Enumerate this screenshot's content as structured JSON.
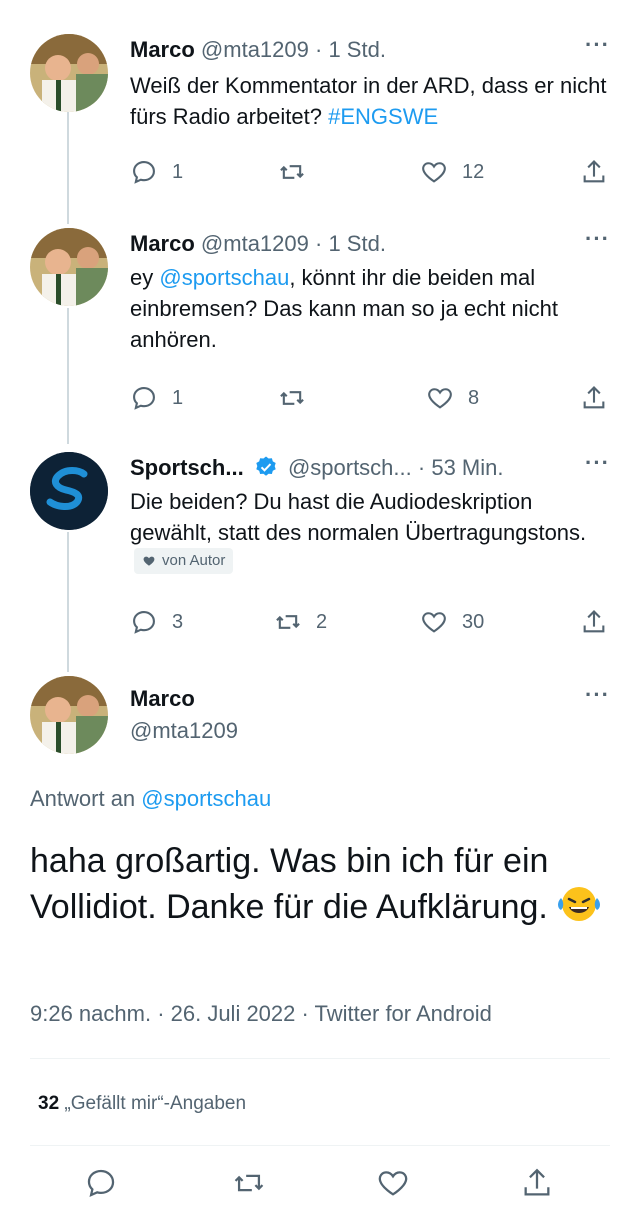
{
  "thread": [
    {
      "name": "Marco",
      "handle": "@mta1209",
      "separator": "·",
      "time": "1 Std.",
      "text_parts": [
        "Weiß der Kommentator in der ARD, dass er nicht fürs Radio arbeitet? ",
        "#ENGSWE"
      ],
      "replies": "1",
      "retweets": "",
      "likes": "12"
    },
    {
      "name": "Marco",
      "handle": "@mta1209",
      "separator": "·",
      "time": "1 Std.",
      "text_parts": [
        "ey ",
        "@sportschau",
        ", könnt ihr die beiden mal einbremsen? Das kann man so ja echt nicht anhören."
      ],
      "replies": "1",
      "retweets": "",
      "likes": "8"
    },
    {
      "name": "Sportsch...",
      "handle": "@sportsch...",
      "separator": "·",
      "time": "53 Min.",
      "text_parts": [
        "Die beiden? Du hast die Audiodeskription gewählt, statt des normalen Übertragungstons."
      ],
      "badge": "von Autor",
      "replies": "3",
      "retweets": "2",
      "likes": "30"
    }
  ],
  "main_tweet": {
    "name": "Marco",
    "handle": "@mta1209",
    "reply_prefix": "Antwort an ",
    "reply_handle": "@sportschau",
    "text": "haha großartig. Was bin ich für ein Vollidiot. Danke für die Aufklärung.",
    "timestamp": "9:26 nachm. · 26. Juli 2022 · Twitter for Android",
    "likes_count": "32",
    "likes_label": "„Gefällt mir“-Angaben"
  },
  "more_icon": "more-dots-icon",
  "colors": {
    "link": "#1d9bf0",
    "muted": "#536471",
    "verified": "#1d9bf0",
    "text": "#0f1419"
  }
}
